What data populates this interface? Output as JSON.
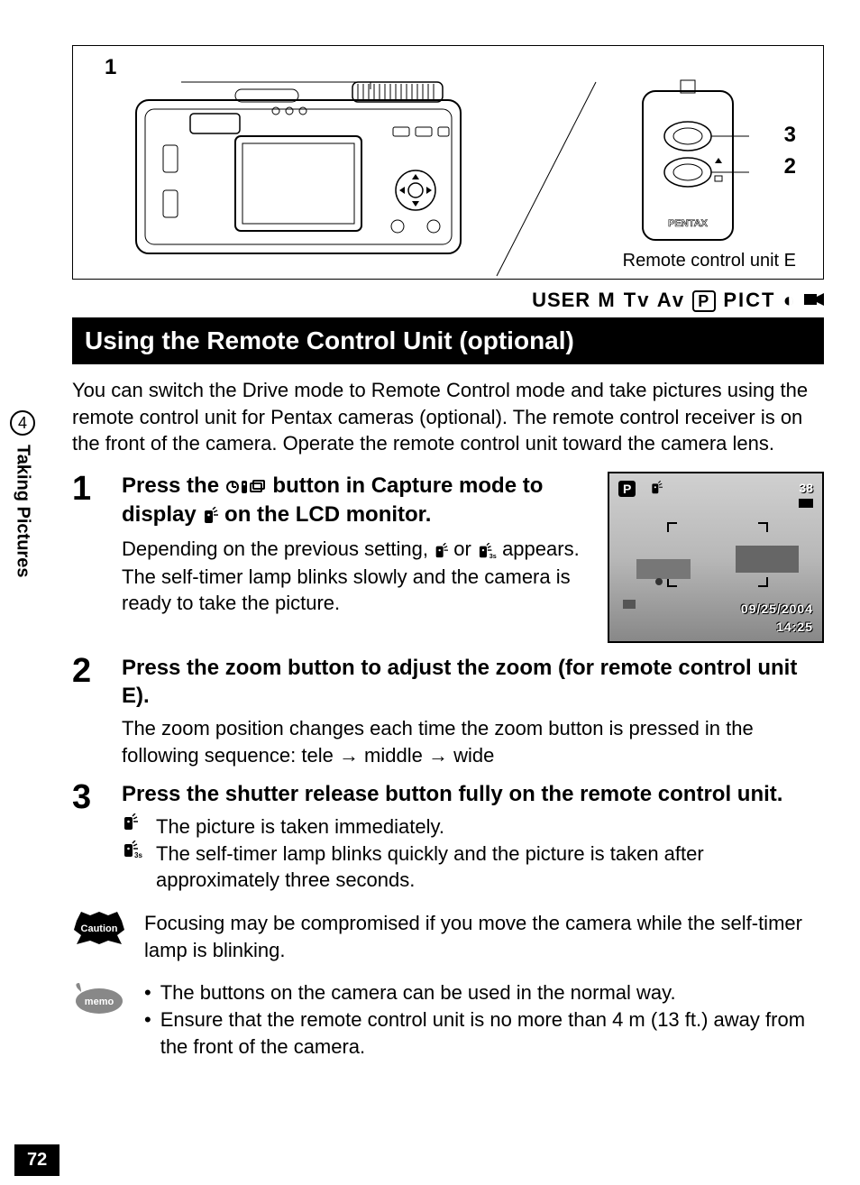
{
  "figure": {
    "label1": "1",
    "label2": "2",
    "label3": "3",
    "remote_caption": "Remote control unit E",
    "remote_brand": "PENTAX"
  },
  "modes": {
    "user": "USER",
    "m": "M",
    "tv": "Tv",
    "av": "Av",
    "p": "P",
    "pict": "PICT"
  },
  "section_title": "Using the Remote Control Unit (optional)",
  "intro": "You can switch the Drive mode to Remote Control mode and take pictures using the remote control unit for Pentax cameras (optional). The remote control receiver is on the front of the camera. Operate the remote control unit toward the camera lens.",
  "steps": [
    {
      "num": "1",
      "title_pre": "Press the ",
      "title_mid": " button in Capture mode to display ",
      "title_post": " on the LCD monitor.",
      "text1_pre": "Depending on the previous setting, ",
      "text1_mid": " or ",
      "text1_post": " appears.",
      "text2": "The self-timer lamp blinks slowly and the camera is ready to take the picture."
    },
    {
      "num": "2",
      "title": "Press the zoom button to adjust the zoom (for remote control unit E).",
      "text_pre": "The zoom position changes each time the zoom button is pressed in the following sequence: tele ",
      "arrow": "→",
      "text_mid": " middle ",
      "text_post": " wide"
    },
    {
      "num": "3",
      "title": "Press the shutter release button fully on the remote control unit.",
      "r1": "The picture is taken immediately.",
      "r2": "The self-timer lamp blinks quickly and the picture is taken after approximately three seconds."
    }
  ],
  "lcd": {
    "p": "P",
    "count": "38",
    "date": "09/25/2004",
    "time": "14:25"
  },
  "caution": {
    "label": "Caution",
    "text": "Focusing may be compromised if you move the camera while the self-timer lamp is blinking."
  },
  "memo": {
    "label": "memo",
    "b1": "The buttons on the camera can be used in the normal way.",
    "b2": "Ensure that the remote control unit is no more than 4 m (13 ft.) away from the front of the camera."
  },
  "side": {
    "chapter": "4",
    "label": "Taking Pictures"
  },
  "page_number": "72",
  "icons": {
    "drive_button": "drive-mode-button",
    "remote": "remote-icon",
    "remote3s": "remote-3s-icon"
  }
}
